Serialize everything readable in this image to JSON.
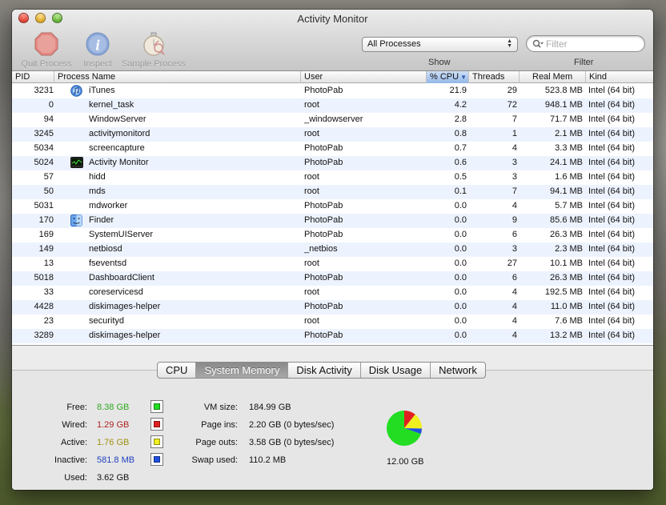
{
  "window": {
    "title": "Activity Monitor"
  },
  "toolbar": {
    "quit_label": "Quit Process",
    "inspect_label": "Inspect",
    "sample_label": "Sample Process",
    "show_select_value": "All Processes",
    "show_label": "Show",
    "filter_placeholder": "Filter",
    "filter_label": "Filter"
  },
  "table": {
    "headers": {
      "pid": "PID",
      "name": "Process Name",
      "user": "User",
      "cpu": "% CPU",
      "threads": "Threads",
      "mem": "Real Mem",
      "kind": "Kind"
    },
    "rows": [
      {
        "pid": "3231",
        "name": "iTunes",
        "user": "PhotoPab",
        "cpu": "21.9",
        "threads": "29",
        "mem": "523.8 MB",
        "kind": "Intel (64 bit)",
        "icon": "itunes-icon"
      },
      {
        "pid": "0",
        "name": "kernel_task",
        "user": "root",
        "cpu": "4.2",
        "threads": "72",
        "mem": "948.1 MB",
        "kind": "Intel (64 bit)",
        "icon": ""
      },
      {
        "pid": "94",
        "name": "WindowServer",
        "user": "_windowserver",
        "cpu": "2.8",
        "threads": "7",
        "mem": "71.7 MB",
        "kind": "Intel (64 bit)",
        "icon": ""
      },
      {
        "pid": "3245",
        "name": "activitymonitord",
        "user": "root",
        "cpu": "0.8",
        "threads": "1",
        "mem": "2.1 MB",
        "kind": "Intel (64 bit)",
        "icon": ""
      },
      {
        "pid": "5034",
        "name": "screencapture",
        "user": "PhotoPab",
        "cpu": "0.7",
        "threads": "4",
        "mem": "3.3 MB",
        "kind": "Intel (64 bit)",
        "icon": ""
      },
      {
        "pid": "5024",
        "name": "Activity Monitor",
        "user": "PhotoPab",
        "cpu": "0.6",
        "threads": "3",
        "mem": "24.1 MB",
        "kind": "Intel (64 bit)",
        "icon": "activity-monitor-icon"
      },
      {
        "pid": "57",
        "name": "hidd",
        "user": "root",
        "cpu": "0.5",
        "threads": "3",
        "mem": "1.6 MB",
        "kind": "Intel (64 bit)",
        "icon": ""
      },
      {
        "pid": "50",
        "name": "mds",
        "user": "root",
        "cpu": "0.1",
        "threads": "7",
        "mem": "94.1 MB",
        "kind": "Intel (64 bit)",
        "icon": ""
      },
      {
        "pid": "5031",
        "name": "mdworker",
        "user": "PhotoPab",
        "cpu": "0.0",
        "threads": "4",
        "mem": "5.7 MB",
        "kind": "Intel (64 bit)",
        "icon": ""
      },
      {
        "pid": "170",
        "name": "Finder",
        "user": "PhotoPab",
        "cpu": "0.0",
        "threads": "9",
        "mem": "85.6 MB",
        "kind": "Intel (64 bit)",
        "icon": "finder-icon"
      },
      {
        "pid": "169",
        "name": "SystemUIServer",
        "user": "PhotoPab",
        "cpu": "0.0",
        "threads": "6",
        "mem": "26.3 MB",
        "kind": "Intel (64 bit)",
        "icon": ""
      },
      {
        "pid": "149",
        "name": "netbiosd",
        "user": "_netbios",
        "cpu": "0.0",
        "threads": "3",
        "mem": "2.3 MB",
        "kind": "Intel (64 bit)",
        "icon": ""
      },
      {
        "pid": "13",
        "name": "fseventsd",
        "user": "root",
        "cpu": "0.0",
        "threads": "27",
        "mem": "10.1 MB",
        "kind": "Intel (64 bit)",
        "icon": ""
      },
      {
        "pid": "5018",
        "name": "DashboardClient",
        "user": "PhotoPab",
        "cpu": "0.0",
        "threads": "6",
        "mem": "26.3 MB",
        "kind": "Intel (64 bit)",
        "icon": ""
      },
      {
        "pid": "33",
        "name": "coreservicesd",
        "user": "root",
        "cpu": "0.0",
        "threads": "4",
        "mem": "192.5 MB",
        "kind": "Intel (64 bit)",
        "icon": ""
      },
      {
        "pid": "4428",
        "name": "diskimages-helper",
        "user": "PhotoPab",
        "cpu": "0.0",
        "threads": "4",
        "mem": "11.0 MB",
        "kind": "Intel (64 bit)",
        "icon": ""
      },
      {
        "pid": "23",
        "name": "securityd",
        "user": "root",
        "cpu": "0.0",
        "threads": "4",
        "mem": "7.6 MB",
        "kind": "Intel (64 bit)",
        "icon": ""
      },
      {
        "pid": "3289",
        "name": "diskimages-helper",
        "user": "PhotoPab",
        "cpu": "0.0",
        "threads": "4",
        "mem": "13.2 MB",
        "kind": "Intel (64 bit)",
        "icon": ""
      }
    ]
  },
  "tabs": [
    "CPU",
    "System Memory",
    "Disk Activity",
    "Disk Usage",
    "Network"
  ],
  "active_tab": "System Memory",
  "memory": {
    "free": {
      "label": "Free:",
      "value": "8.38 GB",
      "color": "#2ea820",
      "swatch": "#22dd22"
    },
    "wired": {
      "label": "Wired:",
      "value": "1.29 GB",
      "color": "#b02020",
      "swatch": "#e02020"
    },
    "active": {
      "label": "Active:",
      "value": "1.76 GB",
      "color": "#a09010",
      "swatch": "#f0f020"
    },
    "inactive": {
      "label": "Inactive:",
      "value": "581.8 MB",
      "color": "#2040c0",
      "swatch": "#2050e0"
    },
    "used": {
      "label": "Used:",
      "value": "3.62 GB"
    },
    "vm_size": {
      "label": "VM size:",
      "value": "184.99 GB"
    },
    "page_ins": {
      "label": "Page ins:",
      "value": "2.20 GB (0 bytes/sec)"
    },
    "page_outs": {
      "label": "Page outs:",
      "value": "3.58 GB (0 bytes/sec)"
    },
    "swap_used": {
      "label": "Swap used:",
      "value": "110.2 MB"
    },
    "total": "12.00 GB",
    "pie_gb": {
      "free": 8.38,
      "wired": 1.29,
      "active": 1.76,
      "inactive": 0.5818
    }
  }
}
